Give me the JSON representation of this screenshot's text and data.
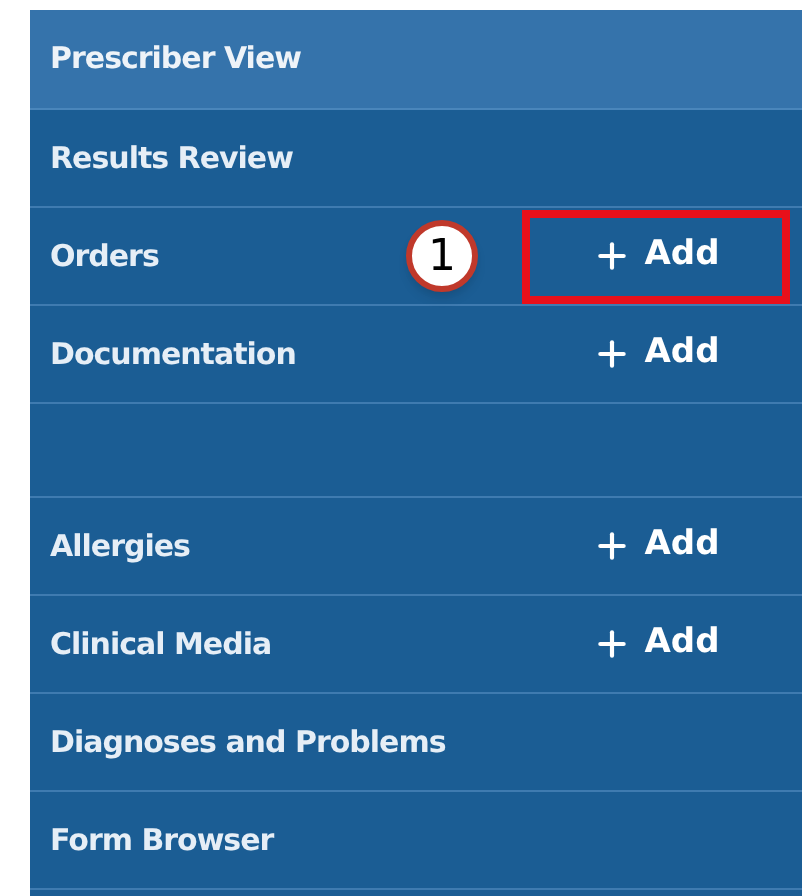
{
  "header": {
    "title": "Prescriber View"
  },
  "items": [
    {
      "kind": "plain",
      "label": "Results Review"
    },
    {
      "kind": "add",
      "label": "Orders",
      "action": "Add",
      "highlighted": true,
      "callout": "1"
    },
    {
      "kind": "add",
      "label": "Documentation",
      "action": "Add",
      "highlighted": false
    },
    {
      "kind": "spacer"
    },
    {
      "kind": "add",
      "label": "Allergies",
      "action": "Add",
      "highlighted": false
    },
    {
      "kind": "add",
      "label": "Clinical Media",
      "action": "Add",
      "highlighted": false
    },
    {
      "kind": "plain",
      "label": "Diagnoses and Problems"
    },
    {
      "kind": "plain",
      "label": "Form Browser"
    }
  ]
}
